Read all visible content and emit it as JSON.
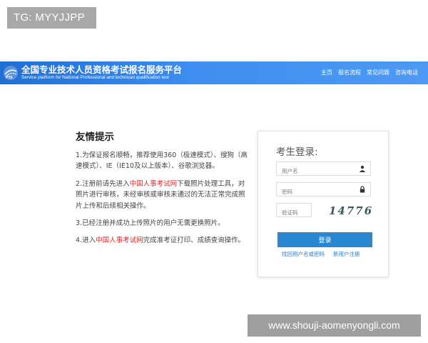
{
  "watermark_top": "TG: MYYJJPP",
  "watermark_bottom": "www.shouji-aomenyongli.com",
  "header": {
    "title": "全国专业技术人员资格考试报名服务平台",
    "subtitle": "Service platform for National Professional and technican qualification test",
    "logo_text": "PTA",
    "nav": [
      "主页",
      "报名流程",
      "常见问题",
      "咨询电话"
    ],
    "colors": {
      "bar_start": "#1f6fd4",
      "bar_end": "#4c9af5"
    }
  },
  "tips": {
    "heading": "友情提示",
    "item1": "1.为保证报名顺畅，推荐使用360（极速模式）、搜狗（高速模式）、IE（IE10及以上版本）、谷歌浏览器。",
    "item2_pre": "2.注册前请先进入",
    "item2_link": "中国人事考试网",
    "item2_post": "下载照片处理工具，对照片进行审核，未经审核或审核未通过的无法正常完成照片上传和后续相关操作。",
    "item3": "3.已经注册并成功上传照片的用户无需更换照片。",
    "item4_pre": "4.进入",
    "item4_link": "中国人事考试网",
    "item4_post": "完成准考证打印、成绩查询操作。",
    "link_color": "#e0262b"
  },
  "login": {
    "title": "考生登录:",
    "username_placeholder": "用户名",
    "password_placeholder": "密码",
    "captcha_placeholder": "验证码",
    "captcha_text": "14776",
    "button": "登录",
    "forgot_link": "找回用户名或密码",
    "register_link": "新用户注册",
    "icons": {
      "user": "user-icon",
      "password": "lock-icon"
    },
    "button_color": "#2a86cf"
  }
}
